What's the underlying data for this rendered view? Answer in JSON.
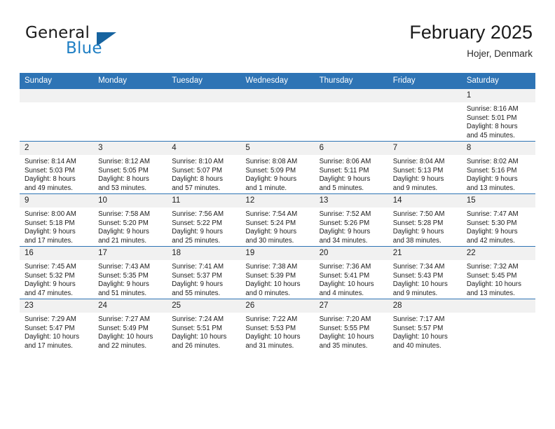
{
  "brand": {
    "name_part1": "General",
    "name_part2": "Blue",
    "accent_color": "#1f7fc4",
    "triangle_color": "#16639f",
    "triangle_icon": "triangle-icon"
  },
  "header": {
    "title": "February 2025",
    "location": "Hojer, Denmark"
  },
  "calendar": {
    "header_color": "#2e74b5",
    "weekday_headers": [
      "Sunday",
      "Monday",
      "Tuesday",
      "Wednesday",
      "Thursday",
      "Friday",
      "Saturday"
    ],
    "weeks": [
      [
        {
          "day": "",
          "empty": true,
          "lines": []
        },
        {
          "day": "",
          "empty": true,
          "lines": []
        },
        {
          "day": "",
          "empty": true,
          "lines": []
        },
        {
          "day": "",
          "empty": true,
          "lines": []
        },
        {
          "day": "",
          "empty": true,
          "lines": []
        },
        {
          "day": "",
          "empty": true,
          "lines": []
        },
        {
          "day": "1",
          "empty": false,
          "lines": [
            "Sunrise: 8:16 AM",
            "Sunset: 5:01 PM",
            "Daylight: 8 hours",
            "and 45 minutes."
          ]
        }
      ],
      [
        {
          "day": "2",
          "empty": false,
          "lines": [
            "Sunrise: 8:14 AM",
            "Sunset: 5:03 PM",
            "Daylight: 8 hours",
            "and 49 minutes."
          ]
        },
        {
          "day": "3",
          "empty": false,
          "lines": [
            "Sunrise: 8:12 AM",
            "Sunset: 5:05 PM",
            "Daylight: 8 hours",
            "and 53 minutes."
          ]
        },
        {
          "day": "4",
          "empty": false,
          "lines": [
            "Sunrise: 8:10 AM",
            "Sunset: 5:07 PM",
            "Daylight: 8 hours",
            "and 57 minutes."
          ]
        },
        {
          "day": "5",
          "empty": false,
          "lines": [
            "Sunrise: 8:08 AM",
            "Sunset: 5:09 PM",
            "Daylight: 9 hours",
            "and 1 minute."
          ]
        },
        {
          "day": "6",
          "empty": false,
          "lines": [
            "Sunrise: 8:06 AM",
            "Sunset: 5:11 PM",
            "Daylight: 9 hours",
            "and 5 minutes."
          ]
        },
        {
          "day": "7",
          "empty": false,
          "lines": [
            "Sunrise: 8:04 AM",
            "Sunset: 5:13 PM",
            "Daylight: 9 hours",
            "and 9 minutes."
          ]
        },
        {
          "day": "8",
          "empty": false,
          "lines": [
            "Sunrise: 8:02 AM",
            "Sunset: 5:16 PM",
            "Daylight: 9 hours",
            "and 13 minutes."
          ]
        }
      ],
      [
        {
          "day": "9",
          "empty": false,
          "lines": [
            "Sunrise: 8:00 AM",
            "Sunset: 5:18 PM",
            "Daylight: 9 hours",
            "and 17 minutes."
          ]
        },
        {
          "day": "10",
          "empty": false,
          "lines": [
            "Sunrise: 7:58 AM",
            "Sunset: 5:20 PM",
            "Daylight: 9 hours",
            "and 21 minutes."
          ]
        },
        {
          "day": "11",
          "empty": false,
          "lines": [
            "Sunrise: 7:56 AM",
            "Sunset: 5:22 PM",
            "Daylight: 9 hours",
            "and 25 minutes."
          ]
        },
        {
          "day": "12",
          "empty": false,
          "lines": [
            "Sunrise: 7:54 AM",
            "Sunset: 5:24 PM",
            "Daylight: 9 hours",
            "and 30 minutes."
          ]
        },
        {
          "day": "13",
          "empty": false,
          "lines": [
            "Sunrise: 7:52 AM",
            "Sunset: 5:26 PM",
            "Daylight: 9 hours",
            "and 34 minutes."
          ]
        },
        {
          "day": "14",
          "empty": false,
          "lines": [
            "Sunrise: 7:50 AM",
            "Sunset: 5:28 PM",
            "Daylight: 9 hours",
            "and 38 minutes."
          ]
        },
        {
          "day": "15",
          "empty": false,
          "lines": [
            "Sunrise: 7:47 AM",
            "Sunset: 5:30 PM",
            "Daylight: 9 hours",
            "and 42 minutes."
          ]
        }
      ],
      [
        {
          "day": "16",
          "empty": false,
          "lines": [
            "Sunrise: 7:45 AM",
            "Sunset: 5:32 PM",
            "Daylight: 9 hours",
            "and 47 minutes."
          ]
        },
        {
          "day": "17",
          "empty": false,
          "lines": [
            "Sunrise: 7:43 AM",
            "Sunset: 5:35 PM",
            "Daylight: 9 hours",
            "and 51 minutes."
          ]
        },
        {
          "day": "18",
          "empty": false,
          "lines": [
            "Sunrise: 7:41 AM",
            "Sunset: 5:37 PM",
            "Daylight: 9 hours",
            "and 55 minutes."
          ]
        },
        {
          "day": "19",
          "empty": false,
          "lines": [
            "Sunrise: 7:38 AM",
            "Sunset: 5:39 PM",
            "Daylight: 10 hours",
            "and 0 minutes."
          ]
        },
        {
          "day": "20",
          "empty": false,
          "lines": [
            "Sunrise: 7:36 AM",
            "Sunset: 5:41 PM",
            "Daylight: 10 hours",
            "and 4 minutes."
          ]
        },
        {
          "day": "21",
          "empty": false,
          "lines": [
            "Sunrise: 7:34 AM",
            "Sunset: 5:43 PM",
            "Daylight: 10 hours",
            "and 9 minutes."
          ]
        },
        {
          "day": "22",
          "empty": false,
          "lines": [
            "Sunrise: 7:32 AM",
            "Sunset: 5:45 PM",
            "Daylight: 10 hours",
            "and 13 minutes."
          ]
        }
      ],
      [
        {
          "day": "23",
          "empty": false,
          "lines": [
            "Sunrise: 7:29 AM",
            "Sunset: 5:47 PM",
            "Daylight: 10 hours",
            "and 17 minutes."
          ]
        },
        {
          "day": "24",
          "empty": false,
          "lines": [
            "Sunrise: 7:27 AM",
            "Sunset: 5:49 PM",
            "Daylight: 10 hours",
            "and 22 minutes."
          ]
        },
        {
          "day": "25",
          "empty": false,
          "lines": [
            "Sunrise: 7:24 AM",
            "Sunset: 5:51 PM",
            "Daylight: 10 hours",
            "and 26 minutes."
          ]
        },
        {
          "day": "26",
          "empty": false,
          "lines": [
            "Sunrise: 7:22 AM",
            "Sunset: 5:53 PM",
            "Daylight: 10 hours",
            "and 31 minutes."
          ]
        },
        {
          "day": "27",
          "empty": false,
          "lines": [
            "Sunrise: 7:20 AM",
            "Sunset: 5:55 PM",
            "Daylight: 10 hours",
            "and 35 minutes."
          ]
        },
        {
          "day": "28",
          "empty": false,
          "lines": [
            "Sunrise: 7:17 AM",
            "Sunset: 5:57 PM",
            "Daylight: 10 hours",
            "and 40 minutes."
          ]
        },
        {
          "day": "",
          "empty": true,
          "lines": []
        }
      ]
    ]
  }
}
